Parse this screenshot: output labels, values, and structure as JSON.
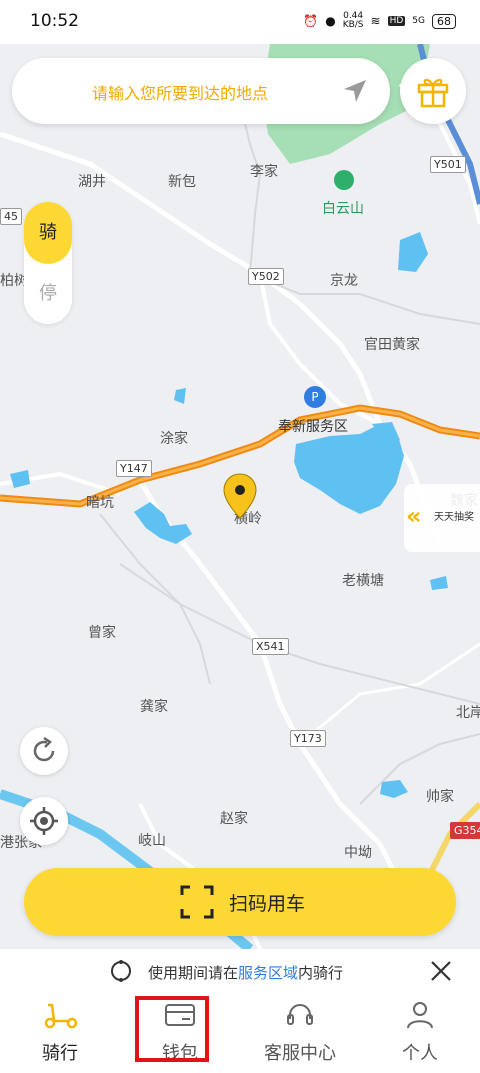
{
  "status_bar": {
    "time": "10:52",
    "net_speed": "0.44",
    "net_unit": "KB/S",
    "hd": "HD",
    "signal": "5G",
    "battery": "68"
  },
  "search": {
    "placeholder": "请输入您所要到达的地点"
  },
  "mode_toggle": {
    "ride": "骑",
    "park": "停"
  },
  "map": {
    "labels": {
      "hujing": "湖井",
      "xinbao": "新包",
      "lijia": "李家",
      "baiyunshan": "白云山",
      "jinglong": "京龙",
      "guantian": "官田黄家",
      "fengxin": "奉新服务区",
      "tujia": "涂家",
      "ankeng": "暗坑",
      "hengling": "横岭",
      "laohengtang": "老横塘",
      "zengjia": "曾家",
      "gongjia": "龚家",
      "zhaojia": "赵家",
      "qishan": "岐山",
      "zhongao": "中坳",
      "shuaijia": "帅家",
      "bai": "柏树",
      "gangzhang": "港张家",
      "bei": "北岸",
      "weijia": "魏家"
    },
    "road_tags": {
      "y501": "Y501",
      "y502": "Y502",
      "y147": "Y147",
      "x541": "X541",
      "y173": "Y173",
      "g354": "G354",
      "n45": "45"
    }
  },
  "side_promo": {
    "label": "天天抽奖"
  },
  "scan_button": {
    "label": "扫码用车"
  },
  "notice": {
    "prefix": "使用期间请在",
    "link": "服务区域",
    "suffix": "内骑行"
  },
  "bottom_nav": [
    {
      "label": "骑行"
    },
    {
      "label": "钱包"
    },
    {
      "label": "客服中心"
    },
    {
      "label": "个人"
    }
  ],
  "colors": {
    "accent": "#fdd835",
    "link": "#2f7de1",
    "highlight": "#e01414"
  }
}
